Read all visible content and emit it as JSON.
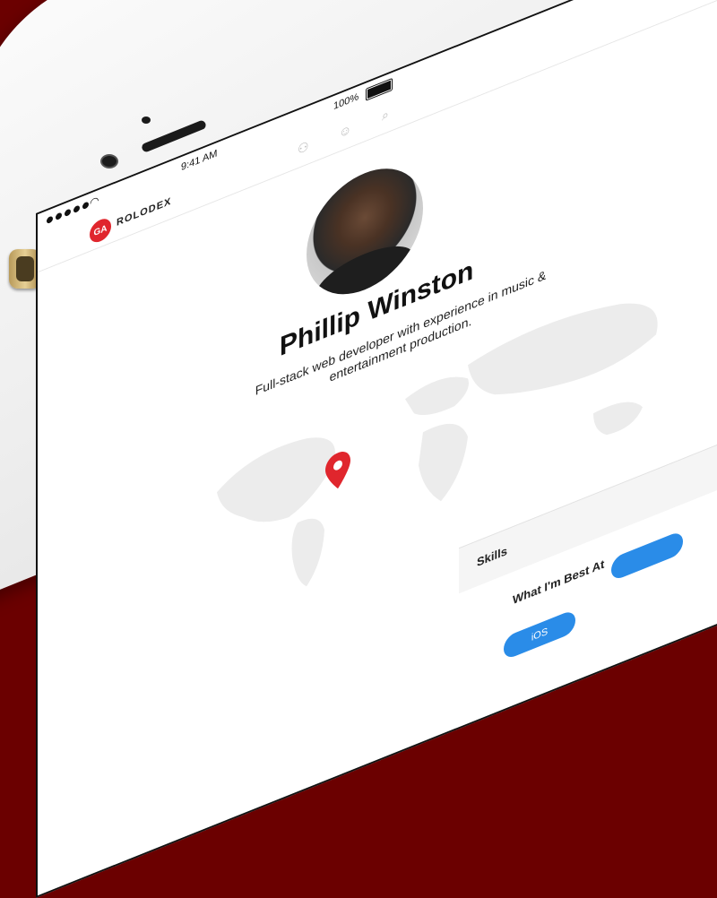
{
  "status_bar": {
    "time": "9:41 AM",
    "battery": "100%"
  },
  "app": {
    "logo_text": "GA",
    "title": "ROLODEX"
  },
  "profile": {
    "name": "Phillip Winston",
    "bio": "Full-stack web developer with experience in music & entertainment production."
  },
  "skills": {
    "section_label": "Skills",
    "heading": "What I'm Best At",
    "items": [
      "iOS",
      ""
    ]
  },
  "colors": {
    "background": "#6b0000",
    "accent": "#e0262d",
    "pill": "#2a8ce8"
  },
  "icons": {
    "header": [
      "group-icon",
      "user-icon",
      "search-icon"
    ],
    "map_pin": "map-pin-icon"
  }
}
